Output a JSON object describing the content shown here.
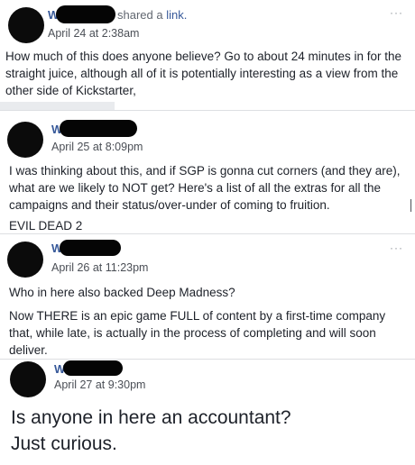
{
  "posts": [
    {
      "name_initial": "W",
      "action": "shared a",
      "action_link": "link.",
      "time": "April 24 at 2:38am",
      "text": "How much of this does anyone believe? Go to about 24 minutes in for the straight juice, although all of it is potentially interesting as a view from the other side of Kickstarter,"
    },
    {
      "name_initial": "W",
      "time": "April 25 at 8:09pm",
      "text": "I was thinking about this, and if SGP is gonna cut corners (and they are), what are we likely to NOT get? Here's a list of all the extras for all the campaigns and their status/over-under of coming to fruition.",
      "text2": "EVIL DEAD 2"
    },
    {
      "name_initial": "W",
      "time": "April 26 at 11:23pm",
      "text": "Who in here also backed Deep Madness?",
      "text2": "Now THERE is an epic game FULL of content by a first-time company that, while late, is actually in the process of completing and will soon deliver."
    },
    {
      "name_initial": "W",
      "time": "April 27 at 9:30pm",
      "text": "Is anyone in here an accountant?\nJust curious."
    }
  ],
  "more_glyph": "···"
}
